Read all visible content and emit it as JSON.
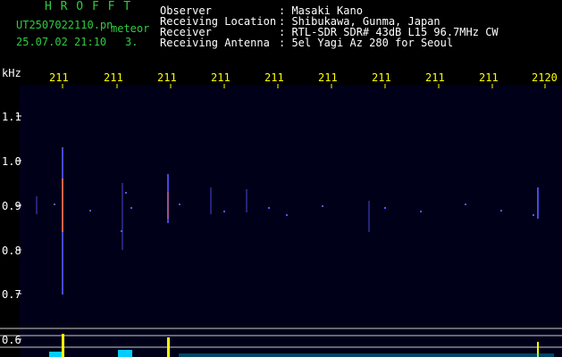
{
  "header": {
    "software": "H R O F F T",
    "filename": "UT2507022110.pn",
    "mode": "meteor",
    "datetime": "25.07.02 21:10",
    "fragment": "3.",
    "fields": [
      {
        "label": "Observer",
        "value": ": Masaki Kano"
      },
      {
        "label": "Receiving Location",
        "value": ": Shibukawa, Gunma, Japan"
      },
      {
        "label": "Receiver",
        "value": ": RTL-SDR SDR# 43dB L15 96.7MHz CW"
      },
      {
        "label": "Receiving Antenna",
        "value": ": 5el Yagi Az 280 for Seoul"
      }
    ]
  },
  "axes": {
    "y_unit": "kHz",
    "y_ticks": [
      "1.1",
      "1.0",
      "0.9",
      "0.8",
      "0.7",
      "0.6"
    ],
    "time_ticks": [
      "211",
      "211",
      "211",
      "211",
      "211",
      "211",
      "211",
      "211",
      "211",
      "2120"
    ]
  },
  "colors": {
    "background": "#000000",
    "spectrogram_bg": "#000018",
    "header_label": "#ffffff",
    "accent_green": "#2ecc40",
    "time_tick": "#ffff00",
    "meteor_trace": "#5555ff",
    "strong_trace": "#ff6633",
    "signal_trace": "#00ccff"
  }
}
